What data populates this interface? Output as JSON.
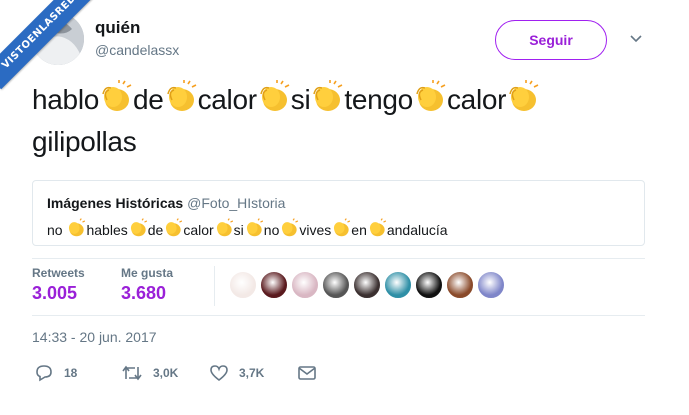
{
  "watermark": "VISTOENLASREDES",
  "author": {
    "name": "quién",
    "handle": "@candelassx"
  },
  "follow_label": "Seguir",
  "tweet": {
    "words": [
      "hablo",
      "de",
      "calor",
      "si",
      "tengo",
      "calor"
    ],
    "last_word": "gilipollas"
  },
  "quoted": {
    "name": "Imágenes Históricas",
    "handle": "@Foto_HIstoria",
    "words": [
      "no",
      "hables",
      "de",
      "calor",
      "si",
      "no",
      "vives",
      "en",
      "andalucía"
    ]
  },
  "stats": {
    "retweets_label": "Retweets",
    "retweets_value": "3.005",
    "likes_label": "Me gusta",
    "likes_value": "3.680"
  },
  "liker_colors": [
    "#f3e9e6",
    "#5a1a1e",
    "#d9b7c3",
    "#565656",
    "#3b3030",
    "#2e8fa6",
    "#111111",
    "#8a4a2a",
    "#7f86c9"
  ],
  "timestamp": "14:33 - 20 jun. 2017",
  "actions": {
    "replies": "18",
    "retweets": "3,0K",
    "likes": "3,7K"
  },
  "colors": {
    "accent": "#9a20d8",
    "muted": "#657786"
  }
}
